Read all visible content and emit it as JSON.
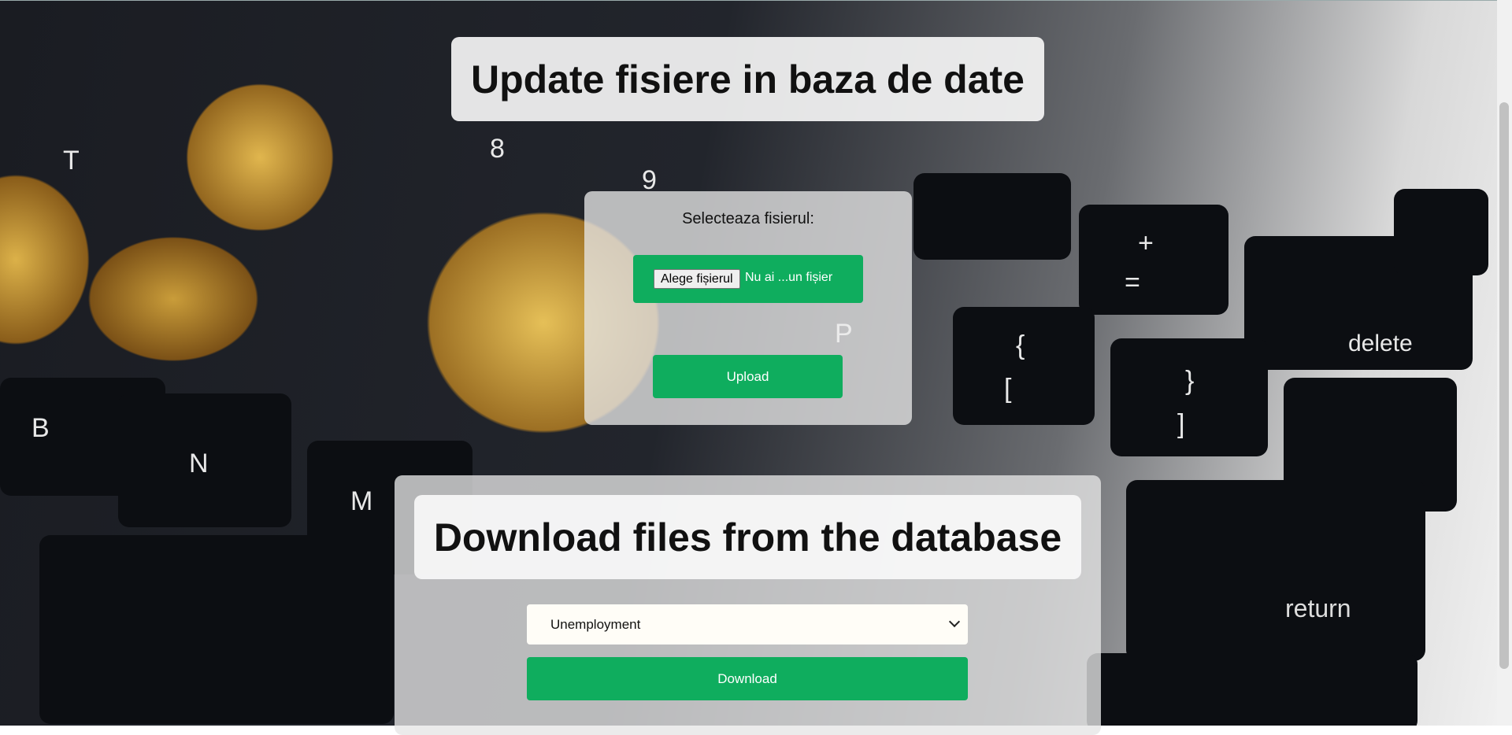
{
  "upload": {
    "title": "Update fisiere in baza de date",
    "select_label": "Selecteaza fisierul:",
    "file_button": "Alege fișierul",
    "file_status": "Nu ai ...un fișier",
    "upload_button": "Upload"
  },
  "download": {
    "title": "Download files from the database",
    "selected_option": "Unemployment",
    "download_button": "Download"
  },
  "background": {
    "keys": [
      "T",
      "B",
      "N",
      "M",
      "P",
      "delete",
      "return",
      "+",
      "=",
      "{",
      "[",
      "}",
      "]",
      "9",
      "8"
    ]
  },
  "colors": {
    "accent": "#0fad5e"
  }
}
